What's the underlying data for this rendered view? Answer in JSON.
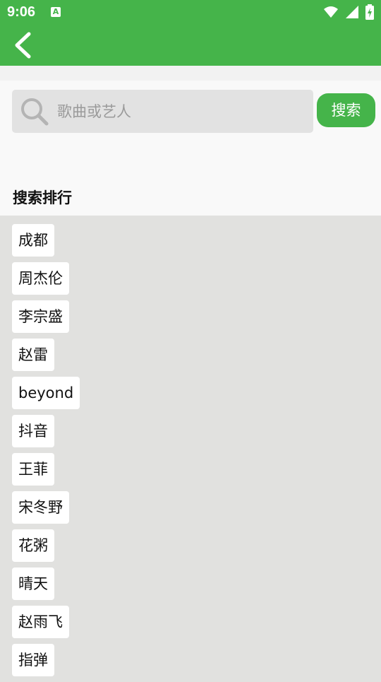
{
  "status_bar": {
    "time": "9:06",
    "app_icon_letter": "A",
    "icons": [
      "wifi-icon",
      "signal-icon",
      "battery-charging-icon"
    ]
  },
  "app_bar": {
    "back_icon": "chevron-left-icon"
  },
  "search": {
    "placeholder": "歌曲或艺人",
    "value": "",
    "button_label": "搜索",
    "icon": "search-icon"
  },
  "ranking": {
    "title": "搜索排行",
    "items": [
      "成都",
      "周杰伦",
      "李宗盛",
      "赵雷",
      "beyond",
      "抖音",
      "王菲",
      "宋冬野",
      "花粥",
      "晴天",
      "赵雨飞",
      "指弹"
    ]
  },
  "colors": {
    "primary": "#45b44a",
    "list_background": "#e1e1df",
    "search_section_background": "#f9f9f9"
  }
}
